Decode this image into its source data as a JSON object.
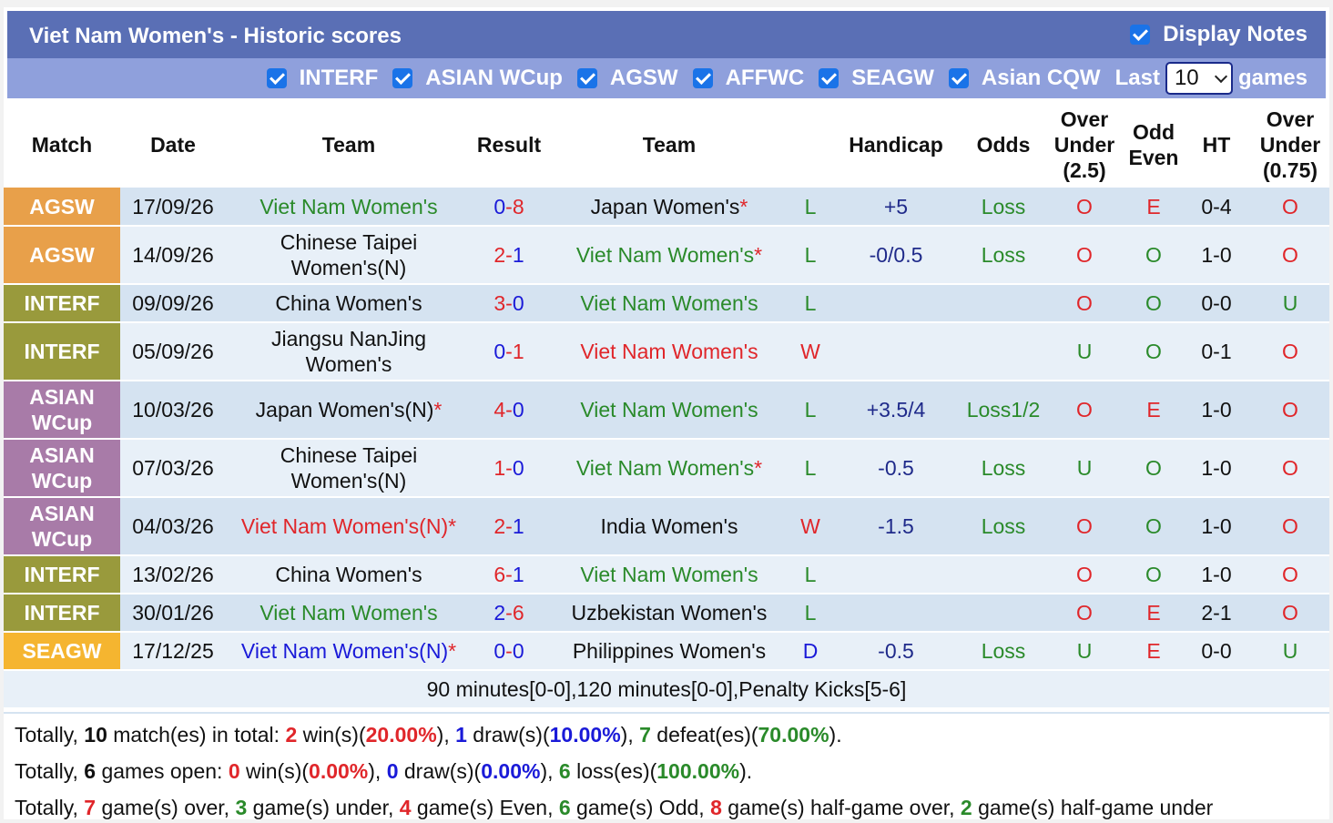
{
  "header": {
    "title": "Viet Nam Women's - Historic scores",
    "display_notes_label": "Display Notes"
  },
  "filters": {
    "items": [
      "INTERF",
      "ASIAN WCup",
      "AGSW",
      "AFFWC",
      "SEAGW",
      "Asian CQW"
    ],
    "last_label": "Last",
    "last_value": "10",
    "games_label": "games"
  },
  "columns": {
    "match": "Match",
    "date": "Date",
    "team1": "Team",
    "result": "Result",
    "team2": "Team",
    "handicap": "Handicap",
    "odds": "Odds",
    "ou_l1": "Over",
    "ou_l2": "Under",
    "ou_l3": "(2.5)",
    "oe_l1": "Odd",
    "oe_l2": "Even",
    "ht": "HT",
    "ou2_l1": "Over",
    "ou2_l2": "Under",
    "ou2_l3": "(0.75)"
  },
  "colors": {
    "AGSW": "#e8a04a",
    "INTERF": "#999a3c",
    "ASIAN WCup": "#a87ba8",
    "SEAGW": "#f5b530"
  },
  "rows": [
    {
      "comp": "AGSW",
      "date": "17/09/26",
      "t1": "Viet Nam Women's",
      "t1_color": "green",
      "t1_star": "",
      "home": "0",
      "away": "8",
      "home_color": "blue",
      "away_color": "red",
      "t2": "Japan Women's",
      "t2_color": "black",
      "t2_star": "*",
      "wl": "L",
      "wl_color": "green",
      "hcp": "+5",
      "odds": "Loss",
      "ou": "O",
      "ou_color": "red",
      "oe": "E",
      "oe_color": "red",
      "ht": "0-4",
      "ou2": "O",
      "ou2_color": "red"
    },
    {
      "comp": "AGSW",
      "date": "14/09/26",
      "t1": "Chinese Taipei",
      "t1b": "Women's(N)",
      "t1_color": "black",
      "t1_star": "",
      "home": "2",
      "away": "1",
      "home_color": "red",
      "away_color": "blue",
      "t2": "Viet Nam Women's",
      "t2_color": "green",
      "t2_star": "*",
      "wl": "L",
      "wl_color": "green",
      "hcp": "-0/0.5",
      "odds": "Loss",
      "ou": "O",
      "ou_color": "red",
      "oe": "O",
      "oe_color": "green",
      "ht": "1-0",
      "ou2": "O",
      "ou2_color": "red"
    },
    {
      "comp": "INTERF",
      "date": "09/09/26",
      "t1": "China Women's",
      "t1_color": "black",
      "t1_star": "",
      "home": "3",
      "away": "0",
      "home_color": "red",
      "away_color": "blue",
      "t2": "Viet Nam Women's",
      "t2_color": "green",
      "t2_star": "",
      "wl": "L",
      "wl_color": "green",
      "hcp": "",
      "odds": "",
      "ou": "O",
      "ou_color": "red",
      "oe": "O",
      "oe_color": "green",
      "ht": "0-0",
      "ou2": "U",
      "ou2_color": "green"
    },
    {
      "comp": "INTERF",
      "date": "05/09/26",
      "t1": "Jiangsu NanJing",
      "t1b": "Women's",
      "t1_color": "black",
      "t1_star": "",
      "home": "0",
      "away": "1",
      "home_color": "blue",
      "away_color": "red",
      "t2": "Viet Nam Women's",
      "t2_color": "red",
      "t2_star": "",
      "wl": "W",
      "wl_color": "red",
      "hcp": "",
      "odds": "",
      "ou": "U",
      "ou_color": "green",
      "oe": "O",
      "oe_color": "green",
      "ht": "0-1",
      "ou2": "O",
      "ou2_color": "red"
    },
    {
      "comp": "ASIAN",
      "comp2": "WCup",
      "compkey": "ASIAN WCup",
      "date": "10/03/26",
      "t1": "Japan Women's(N)",
      "t1_color": "black",
      "t1_star": "*",
      "home": "4",
      "away": "0",
      "home_color": "red",
      "away_color": "blue",
      "t2": "Viet Nam Women's",
      "t2_color": "green",
      "t2_star": "",
      "wl": "L",
      "wl_color": "green",
      "hcp": "+3.5/4",
      "odds": "Loss1/2",
      "ou": "O",
      "ou_color": "red",
      "oe": "E",
      "oe_color": "red",
      "ht": "1-0",
      "ou2": "O",
      "ou2_color": "red"
    },
    {
      "comp": "ASIAN",
      "comp2": "WCup",
      "compkey": "ASIAN WCup",
      "date": "07/03/26",
      "t1": "Chinese Taipei",
      "t1b": "Women's(N)",
      "t1_color": "black",
      "t1_star": "",
      "home": "1",
      "away": "0",
      "home_color": "red",
      "away_color": "blue",
      "t2": "Viet Nam Women's",
      "t2_color": "green",
      "t2_star": "*",
      "wl": "L",
      "wl_color": "green",
      "hcp": "-0.5",
      "odds": "Loss",
      "ou": "U",
      "ou_color": "green",
      "oe": "O",
      "oe_color": "green",
      "ht": "1-0",
      "ou2": "O",
      "ou2_color": "red"
    },
    {
      "comp": "ASIAN",
      "comp2": "WCup",
      "compkey": "ASIAN WCup",
      "date": "04/03/26",
      "t1": "Viet Nam Women's(N)",
      "t1_color": "red",
      "t1_star": "*",
      "home": "2",
      "away": "1",
      "home_color": "red",
      "away_color": "blue",
      "t2": "India Women's",
      "t2_color": "black",
      "t2_star": "",
      "wl": "W",
      "wl_color": "red",
      "hcp": "-1.5",
      "odds": "Loss",
      "ou": "O",
      "ou_color": "red",
      "oe": "O",
      "oe_color": "green",
      "ht": "1-0",
      "ou2": "O",
      "ou2_color": "red"
    },
    {
      "comp": "INTERF",
      "date": "13/02/26",
      "t1": "China Women's",
      "t1_color": "black",
      "t1_star": "",
      "home": "6",
      "away": "1",
      "home_color": "red",
      "away_color": "blue",
      "t2": "Viet Nam Women's",
      "t2_color": "green",
      "t2_star": "",
      "wl": "L",
      "wl_color": "green",
      "hcp": "",
      "odds": "",
      "ou": "O",
      "ou_color": "red",
      "oe": "O",
      "oe_color": "green",
      "ht": "1-0",
      "ou2": "O",
      "ou2_color": "red"
    },
    {
      "comp": "INTERF",
      "date": "30/01/26",
      "t1": "Viet Nam Women's",
      "t1_color": "green",
      "t1_star": "",
      "home": "2",
      "away": "6",
      "home_color": "blue",
      "away_color": "red",
      "t2": "Uzbekistan Women's",
      "t2_color": "black",
      "t2_star": "",
      "wl": "L",
      "wl_color": "green",
      "hcp": "",
      "odds": "",
      "ou": "O",
      "ou_color": "red",
      "oe": "E",
      "oe_color": "red",
      "ht": "2-1",
      "ou2": "O",
      "ou2_color": "red"
    },
    {
      "comp": "SEAGW",
      "date": "17/12/25",
      "t1": "Viet Nam Women's(N)",
      "t1_color": "blue",
      "t1_star": "*",
      "home": "0",
      "away": "0",
      "home_color": "blue",
      "away_color": "blue",
      "t2": "Philippines Women's",
      "t2_color": "black",
      "t2_star": "",
      "wl": "D",
      "wl_color": "blue",
      "hcp": "-0.5",
      "odds": "Loss",
      "ou": "U",
      "ou_color": "green",
      "oe": "E",
      "oe_color": "red",
      "ht": "0-0",
      "ou2": "U",
      "ou2_color": "green"
    }
  ],
  "note": "90 minutes[0-0],120 minutes[0-0],Penalty Kicks[5-6]",
  "summary": {
    "line1": {
      "p1": "Totally, ",
      "n_matches": "10",
      "p2": " match(es) in total: ",
      "wins": "2",
      "p3": " win(s)(",
      "win_pct": "20.00%",
      "p4": "), ",
      "draws": "1",
      "p5": " draw(s)(",
      "draw_pct": "10.00%",
      "p6": "), ",
      "defeats": "7",
      "p7": " defeat(es)(",
      "defeat_pct": "70.00%",
      "p8": ")."
    },
    "line2": {
      "p1": "Totally, ",
      "n_open": "6",
      "p2": " games open: ",
      "wins": "0",
      "p3": " win(s)(",
      "win_pct": "0.00%",
      "p4": "), ",
      "draws": "0",
      "p5": " draw(s)(",
      "draw_pct": "0.00%",
      "p6": "), ",
      "losses": "6",
      "p7": " loss(es)(",
      "loss_pct": "100.00%",
      "p8": ")."
    },
    "line3": {
      "p1": "Totally, ",
      "over": "7",
      "p2": " game(s) over, ",
      "under": "3",
      "p3": " game(s) under, ",
      "even": "4",
      "p4": " game(s) Even, ",
      "odd": "6",
      "p5": " game(s) Odd, ",
      "hg_over": "8",
      "p6": " game(s) half-game over, ",
      "hg_under": "2",
      "p7": " game(s) half-game under"
    }
  }
}
